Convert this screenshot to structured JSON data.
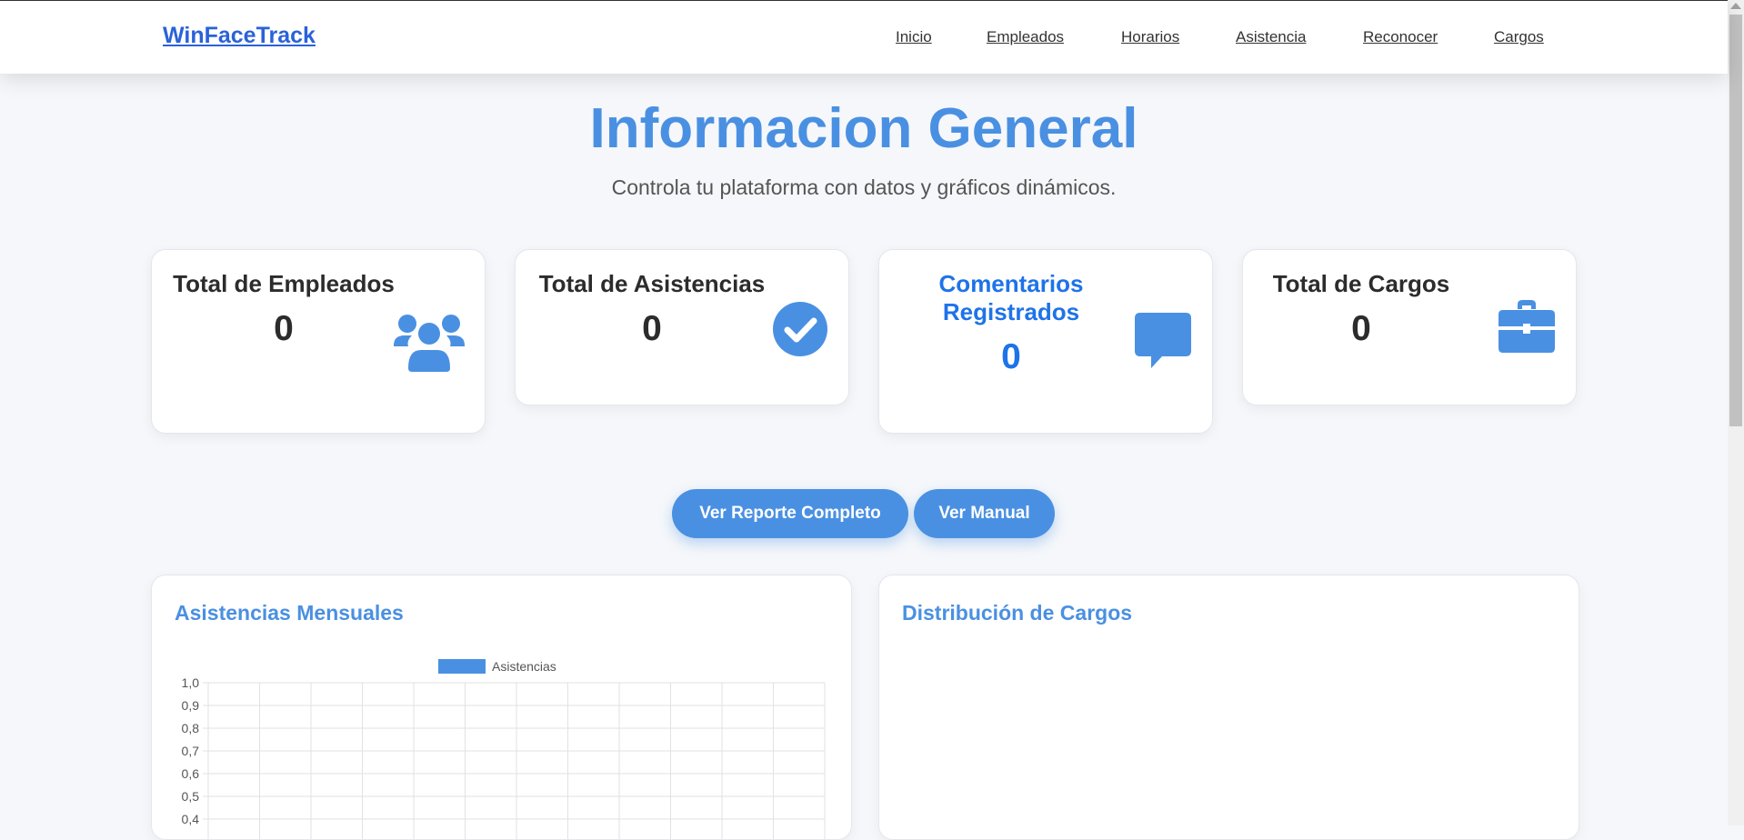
{
  "navbar": {
    "brand": "WinFaceTrack",
    "links": [
      "Inicio",
      "Empleados",
      "Horarios",
      "Asistencia",
      "Reconocer",
      "Cargos"
    ]
  },
  "header": {
    "title": "Informacion General",
    "subtitle": "Controla tu plataforma con datos y gráficos dinámicos."
  },
  "cards": [
    {
      "label": "Total de Empleados",
      "value": "0",
      "icon": "users-icon"
    },
    {
      "label": "Total de Asistencias",
      "value": "0",
      "icon": "check-circle-icon"
    },
    {
      "label": "Comentarios Registrados",
      "value": "0",
      "icon": "comment-icon"
    },
    {
      "label": "Total de Cargos",
      "value": "0",
      "icon": "briefcase-icon"
    }
  ],
  "buttons": {
    "report": "Ver Reporte Completo",
    "manual": "Ver Manual"
  },
  "panels": {
    "attendance_title": "Asistencias Mensuales",
    "distribution_title": "Distribución de Cargos"
  },
  "colors": {
    "accent": "#4a90e2",
    "brand": "#2a62d8",
    "highlight": "#1e73e8"
  },
  "chart_data": {
    "type": "bar",
    "series": [
      {
        "name": "Asistencias",
        "values": []
      }
    ],
    "ylim": [
      0,
      1.0
    ],
    "yticks": [
      "1,0",
      "0,9",
      "0,8",
      "0,7",
      "0,6",
      "0,5",
      "0,4"
    ],
    "grid": true,
    "legend": "top",
    "color": "#4a90e2"
  }
}
